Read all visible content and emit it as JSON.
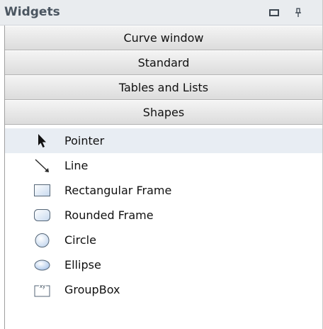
{
  "panel": {
    "title": "Widgets",
    "icons": {
      "restore": "restore-icon",
      "pin": "pin-icon"
    }
  },
  "categories": [
    {
      "label": "Curve window"
    },
    {
      "label": "Standard"
    },
    {
      "label": "Tables and Lists"
    },
    {
      "label": "Shapes",
      "expanded": true
    }
  ],
  "shapes": {
    "items": [
      {
        "label": "Pointer",
        "icon": "pointer-arrow-icon",
        "selected": true
      },
      {
        "label": "Line",
        "icon": "line-icon"
      },
      {
        "label": "Rectangular Frame",
        "icon": "rectangular-frame-icon"
      },
      {
        "label": "Rounded Frame",
        "icon": "rounded-frame-icon"
      },
      {
        "label": "Circle",
        "icon": "circle-icon"
      },
      {
        "label": "Ellipse",
        "icon": "ellipse-icon"
      },
      {
        "label": "GroupBox",
        "icon": "groupbox-icon",
        "icon_text": "xy"
      }
    ]
  },
  "colors": {
    "title_text": "#4a5560",
    "titlebar_bg": "#e9ecef",
    "selected_row": "#e8edf3"
  }
}
